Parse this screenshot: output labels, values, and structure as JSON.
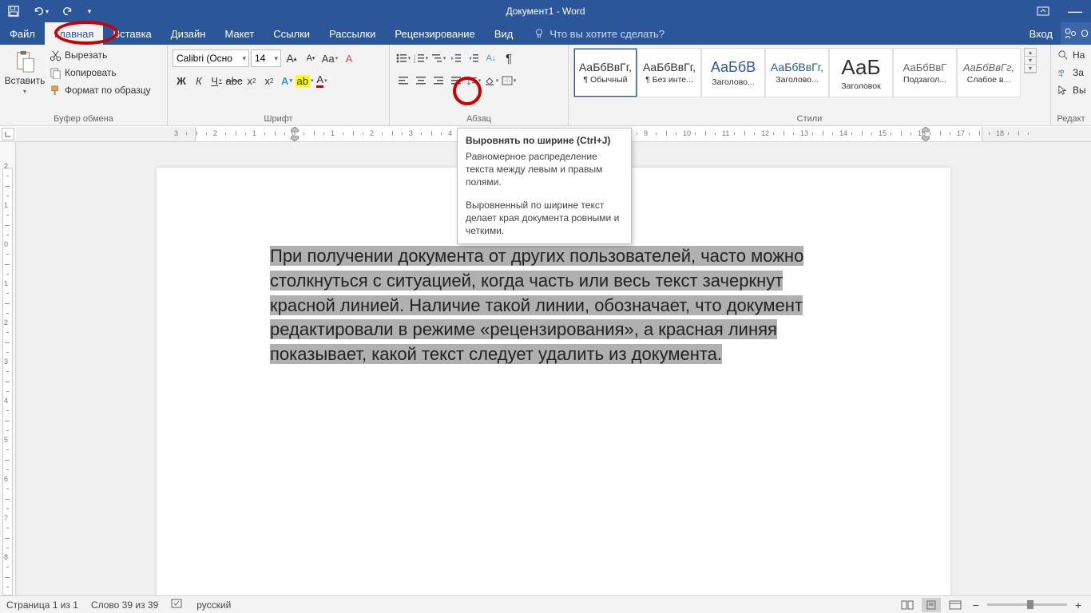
{
  "title": "Документ1 - Word",
  "tabs": {
    "file": "Файл",
    "home": "Главная",
    "insert": "Вставка",
    "design": "Дизайн",
    "layout": "Макет",
    "references": "Ссылки",
    "mailings": "Рассылки",
    "review": "Рецензирование",
    "view": "Вид"
  },
  "tellme": "Что вы хотите сделать?",
  "signin": "Вход",
  "ribbon": {
    "clipboard": {
      "paste": "Вставить",
      "cut": "Вырезать",
      "copy": "Копировать",
      "format_painter": "Формат по образцу",
      "label": "Буфер обмена"
    },
    "font": {
      "name": "Calibri (Осно",
      "size": "14",
      "bold": "Ж",
      "italic": "К",
      "underline": "Ч",
      "label": "Шрифт"
    },
    "paragraph": {
      "label": "Абзац"
    },
    "styles": {
      "label": "Стили",
      "items": [
        {
          "preview": "АаБбВвГг,",
          "label": "¶ Обычный",
          "preview_color": "#333",
          "preview_size": "14px"
        },
        {
          "preview": "АаБбВвГг,",
          "label": "¶ Без инте...",
          "preview_color": "#333",
          "preview_size": "14px"
        },
        {
          "preview": "АаБбВ",
          "label": "Заголово...",
          "preview_color": "#2b579a",
          "preview_size": "18px"
        },
        {
          "preview": "АаБбВвГг,",
          "label": "Заголово...",
          "preview_color": "#2b579a",
          "preview_size": "14px"
        },
        {
          "preview": "АаБ",
          "label": "Заголовок",
          "preview_color": "#333",
          "preview_size": "26px"
        },
        {
          "preview": "АаБбВвГ",
          "label": "Подзагол...",
          "preview_color": "#666",
          "preview_size": "13px"
        },
        {
          "preview": "АаБбВвГг,",
          "label": "Слабое в...",
          "preview_color": "#666",
          "preview_size": "13px",
          "italic": true
        }
      ]
    },
    "editing": {
      "label": "Редакт",
      "find": "На",
      "replace": "За",
      "select": "Вы"
    }
  },
  "tooltip": {
    "title": "Выровнять по ширине (Ctrl+J)",
    "p1": "Равномерное распределение текста между левым и правым полями.",
    "p2": "Выровненный по ширине текст делает края документа ровными и четкими."
  },
  "document_text": "При получении документа от других пользователей, часто можно столкнуться с ситуацией, когда часть или весь текст зачеркнут красной линией. Наличие такой линии, обозначает, что документ редактировали в режиме «рецензирования», а красная линяя показывает, какой текст следует удалить из документа.",
  "status": {
    "page": "Страница 1 из 1",
    "words": "Слово 39 из 39",
    "lang": "русский"
  }
}
